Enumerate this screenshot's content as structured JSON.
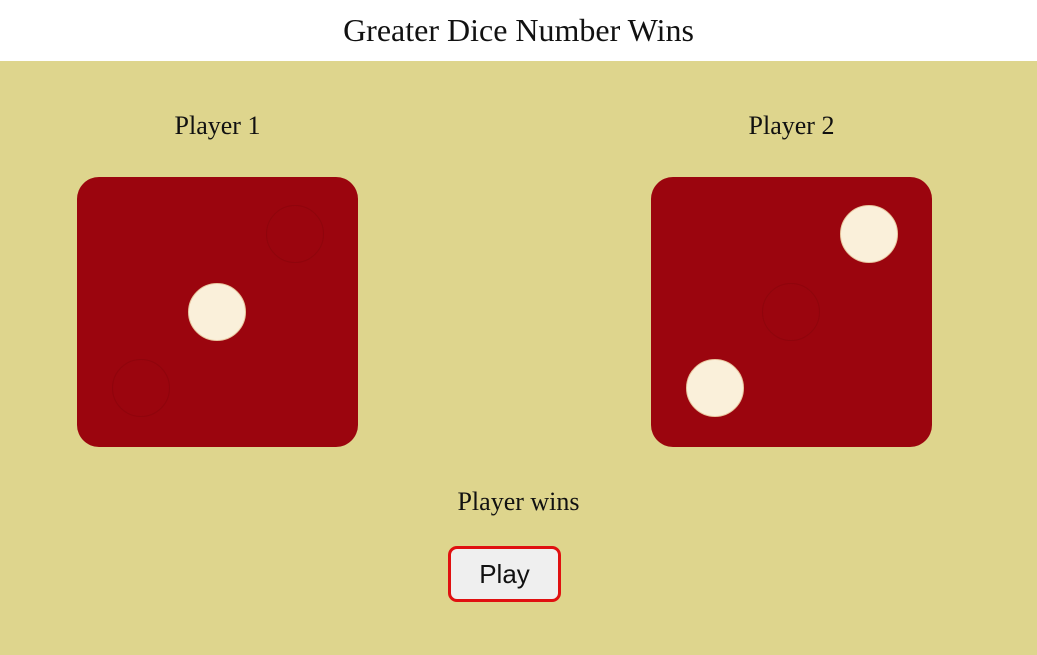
{
  "header": {
    "title": "Greater Dice Number Wins"
  },
  "players": [
    {
      "label": "Player 1",
      "die_value": 1
    },
    {
      "label": "Player 2",
      "die_value": 2
    }
  ],
  "result": {
    "text": "Player wins"
  },
  "controls": {
    "play_label": "Play"
  },
  "colors": {
    "board_background": "#ded58d",
    "die_face": "#9b050e",
    "pip": "#faf0da",
    "button_border": "#e01010"
  }
}
